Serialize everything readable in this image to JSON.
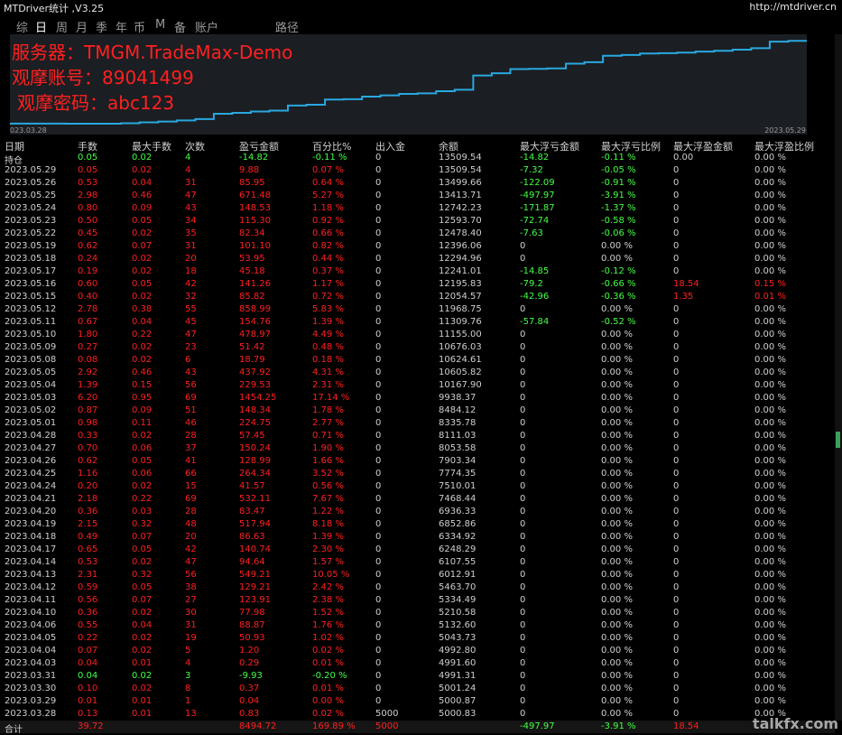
{
  "app_title": "MTDriver统计 ,V3.25",
  "url": "http://mtdriver.cn",
  "tabs": [
    "综",
    "日",
    "周",
    "月",
    "季",
    "年",
    "币",
    "M",
    "备",
    "账户",
    "路径"
  ],
  "active_tab": 1,
  "overlay": {
    "server": "服务器：TMGM.TradeMax-Demo",
    "account": "观摩账号：89041499",
    "password": "观摩密码：abc123"
  },
  "chart_data": {
    "type": "line",
    "x_start_label": "023.03.28",
    "x_end_label": "2023.05.29",
    "line_color": "#29a8e0",
    "series": [
      {
        "x": [
          "2023.03.28",
          "2023.03.29",
          "2023.03.30",
          "2023.03.31",
          "2023.04.03",
          "2023.04.04",
          "2023.04.05",
          "2023.04.06",
          "2023.04.10",
          "2023.04.11",
          "2023.04.12",
          "2023.04.13",
          "2023.04.14",
          "2023.04.17",
          "2023.04.18",
          "2023.04.19",
          "2023.04.20",
          "2023.04.21",
          "2023.04.24",
          "2023.04.25",
          "2023.04.26",
          "2023.04.27",
          "2023.04.28",
          "2023.05.01",
          "2023.05.02",
          "2023.05.03",
          "2023.05.04",
          "2023.05.05",
          "2023.05.08",
          "2023.05.09",
          "2023.05.10",
          "2023.05.11",
          "2023.05.12",
          "2023.05.15",
          "2023.05.16",
          "2023.05.17",
          "2023.05.18",
          "2023.05.19",
          "2023.05.22",
          "2023.05.23",
          "2023.05.24",
          "2023.05.25",
          "2023.05.26",
          "2023.05.29"
        ],
        "values": [
          5000.83,
          5000.87,
          5001.24,
          4991.31,
          4991.6,
          4992.8,
          5043.73,
          5132.6,
          5210.58,
          5334.49,
          5463.7,
          6012.91,
          6107.55,
          6248.29,
          6334.92,
          6852.86,
          6936.33,
          7468.44,
          7510.01,
          7774.35,
          7903.34,
          8053.58,
          8111.03,
          8335.78,
          8484.12,
          9938.37,
          10167.9,
          10605.82,
          10624.61,
          10676.03,
          11155.0,
          11309.76,
          11968.75,
          12054.57,
          12195.83,
          12241.01,
          12294.96,
          12396.06,
          12478.4,
          12593.7,
          12742.23,
          13413.71,
          13499.66,
          13509.54
        ]
      }
    ],
    "ylim": [
      4900,
      13800
    ]
  },
  "table": {
    "headers": [
      "日期",
      "手数",
      "最大手数",
      "次数",
      "盈亏金额",
      "百分比%",
      "出入金",
      "余额",
      "最大浮亏金额",
      "最大浮亏比例",
      "最大浮盈金额",
      "最大浮盈比例"
    ],
    "rows": [
      [
        "持仓",
        "0.05",
        "0.02",
        "4",
        "-14.82",
        "-0.11 %",
        "0",
        "13509.54",
        "-14.82",
        "-0.11 %",
        "0.00",
        "0.00 %"
      ],
      [
        "2023.05.29",
        "0.05",
        "0.02",
        "4",
        "9.88",
        "0.07 %",
        "0",
        "13509.54",
        "-7.32",
        "-0.05 %",
        "0",
        "0.00 %"
      ],
      [
        "2023.05.26",
        "0.53",
        "0.04",
        "31",
        "85.95",
        "0.64 %",
        "0",
        "13499.66",
        "-122.09",
        "-0.91 %",
        "0",
        "0.00 %"
      ],
      [
        "2023.05.25",
        "2.98",
        "0.46",
        "47",
        "671.48",
        "5.27 %",
        "0",
        "13413.71",
        "-497.97",
        "-3.91 %",
        "0",
        "0.00 %"
      ],
      [
        "2023.05.24",
        "0.80",
        "0.09",
        "43",
        "148.53",
        "1.18 %",
        "0",
        "12742.23",
        "-171.87",
        "-1.37 %",
        "0",
        "0.00 %"
      ],
      [
        "2023.05.23",
        "0.50",
        "0.05",
        "34",
        "115.30",
        "0.92 %",
        "0",
        "12593.70",
        "-72.74",
        "-0.58 %",
        "0",
        "0.00 %"
      ],
      [
        "2023.05.22",
        "0.45",
        "0.02",
        "35",
        "82.34",
        "0.66 %",
        "0",
        "12478.40",
        "-7.63",
        "-0.06 %",
        "0",
        "0.00 %"
      ],
      [
        "2023.05.19",
        "0.62",
        "0.07",
        "31",
        "101.10",
        "0.82 %",
        "0",
        "12396.06",
        "0",
        "0.00 %",
        "0",
        "0.00 %"
      ],
      [
        "2023.05.18",
        "0.24",
        "0.02",
        "20",
        "53.95",
        "0.44 %",
        "0",
        "12294.96",
        "0",
        "0.00 %",
        "0",
        "0.00 %"
      ],
      [
        "2023.05.17",
        "0.19",
        "0.02",
        "18",
        "45.18",
        "0.37 %",
        "0",
        "12241.01",
        "-14.85",
        "-0.12 %",
        "0",
        "0.00 %"
      ],
      [
        "2023.05.16",
        "0.60",
        "0.05",
        "42",
        "141.26",
        "1.17 %",
        "0",
        "12195.83",
        "-79.2",
        "-0.66 %",
        "18.54",
        "0.15 %"
      ],
      [
        "2023.05.15",
        "0.40",
        "0.02",
        "32",
        "85.82",
        "0.72 %",
        "0",
        "12054.57",
        "-42.96",
        "-0.36 %",
        "1.35",
        "0.01 %"
      ],
      [
        "2023.05.12",
        "2.78",
        "0.38",
        "55",
        "858.99",
        "5.83 %",
        "0",
        "11968.75",
        "0",
        "0.00 %",
        "0",
        "0.00 %"
      ],
      [
        "2023.05.11",
        "0.67",
        "0.04",
        "45",
        "154.76",
        "1.39 %",
        "0",
        "11309.76",
        "-57.84",
        "-0.52 %",
        "0",
        "0.00 %"
      ],
      [
        "2023.05.10",
        "1.80",
        "0.22",
        "47",
        "478.97",
        "4.49 %",
        "0",
        "11155.00",
        "0",
        "0.00 %",
        "0",
        "0.00 %"
      ],
      [
        "2023.05.09",
        "0.27",
        "0.02",
        "23",
        "51.42",
        "0.48 %",
        "0",
        "10676.03",
        "0",
        "0.00 %",
        "0",
        "0.00 %"
      ],
      [
        "2023.05.08",
        "0.08",
        "0.02",
        "6",
        "18.79",
        "0.18 %",
        "0",
        "10624.61",
        "0",
        "0.00 %",
        "0",
        "0.00 %"
      ],
      [
        "2023.05.05",
        "2.92",
        "0.46",
        "43",
        "437.92",
        "4.31 %",
        "0",
        "10605.82",
        "0",
        "0.00 %",
        "0",
        "0.00 %"
      ],
      [
        "2023.05.04",
        "1.39",
        "0.15",
        "56",
        "229.53",
        "2.31 %",
        "0",
        "10167.90",
        "0",
        "0.00 %",
        "0",
        "0.00 %"
      ],
      [
        "2023.05.03",
        "6.20",
        "0.95",
        "69",
        "1454.25",
        "17.14 %",
        "0",
        "9938.37",
        "0",
        "0.00 %",
        "0",
        "0.00 %"
      ],
      [
        "2023.05.02",
        "0.87",
        "0.09",
        "51",
        "148.34",
        "1.78 %",
        "0",
        "8484.12",
        "0",
        "0.00 %",
        "0",
        "0.00 %"
      ],
      [
        "2023.05.01",
        "0.98",
        "0.11",
        "46",
        "224.75",
        "2.77 %",
        "0",
        "8335.78",
        "0",
        "0.00 %",
        "0",
        "0.00 %"
      ],
      [
        "2023.04.28",
        "0.33",
        "0.02",
        "28",
        "57.45",
        "0.71 %",
        "0",
        "8111.03",
        "0",
        "0.00 %",
        "0",
        "0.00 %"
      ],
      [
        "2023.04.27",
        "0.70",
        "0.06",
        "37",
        "150.24",
        "1.90 %",
        "0",
        "8053.58",
        "0",
        "0.00 %",
        "0",
        "0.00 %"
      ],
      [
        "2023.04.26",
        "0.62",
        "0.05",
        "41",
        "128.99",
        "1.66 %",
        "0",
        "7903.34",
        "0",
        "0.00 %",
        "0",
        "0.00 %"
      ],
      [
        "2023.04.25",
        "1.16",
        "0.06",
        "66",
        "264.34",
        "3.52 %",
        "0",
        "7774.35",
        "0",
        "0.00 %",
        "0",
        "0.00 %"
      ],
      [
        "2023.04.24",
        "0.20",
        "0.02",
        "15",
        "41.57",
        "0.56 %",
        "0",
        "7510.01",
        "0",
        "0.00 %",
        "0",
        "0.00 %"
      ],
      [
        "2023.04.21",
        "2.18",
        "0.22",
        "69",
        "532.11",
        "7.67 %",
        "0",
        "7468.44",
        "0",
        "0.00 %",
        "0",
        "0.00 %"
      ],
      [
        "2023.04.20",
        "0.36",
        "0.03",
        "28",
        "83.47",
        "1.22 %",
        "0",
        "6936.33",
        "0",
        "0.00 %",
        "0",
        "0.00 %"
      ],
      [
        "2023.04.19",
        "2.15",
        "0.32",
        "48",
        "517.94",
        "8.18 %",
        "0",
        "6852.86",
        "0",
        "0.00 %",
        "0",
        "0.00 %"
      ],
      [
        "2023.04.18",
        "0.49",
        "0.07",
        "20",
        "86.63",
        "1.39 %",
        "0",
        "6334.92",
        "0",
        "0.00 %",
        "0",
        "0.00 %"
      ],
      [
        "2023.04.17",
        "0.65",
        "0.05",
        "42",
        "140.74",
        "2.30 %",
        "0",
        "6248.29",
        "0",
        "0.00 %",
        "0",
        "0.00 %"
      ],
      [
        "2023.04.14",
        "0.53",
        "0.02",
        "47",
        "94.64",
        "1.57 %",
        "0",
        "6107.55",
        "0",
        "0.00 %",
        "0",
        "0.00 %"
      ],
      [
        "2023.04.13",
        "2.31",
        "0.32",
        "56",
        "549.21",
        "10.05 %",
        "0",
        "6012.91",
        "0",
        "0.00 %",
        "0",
        "0.00 %"
      ],
      [
        "2023.04.12",
        "0.59",
        "0.05",
        "38",
        "129.21",
        "2.42 %",
        "0",
        "5463.70",
        "0",
        "0.00 %",
        "0",
        "0.00 %"
      ],
      [
        "2023.04.11",
        "0.56",
        "0.07",
        "27",
        "123.91",
        "2.38 %",
        "0",
        "5334.49",
        "0",
        "0.00 %",
        "0",
        "0.00 %"
      ],
      [
        "2023.04.10",
        "0.36",
        "0.02",
        "30",
        "77.98",
        "1.52 %",
        "0",
        "5210.58",
        "0",
        "0.00 %",
        "0",
        "0.00 %"
      ],
      [
        "2023.04.06",
        "0.55",
        "0.04",
        "31",
        "88.87",
        "1.76 %",
        "0",
        "5132.60",
        "0",
        "0.00 %",
        "0",
        "0.00 %"
      ],
      [
        "2023.04.05",
        "0.22",
        "0.02",
        "19",
        "50.93",
        "1.02 %",
        "0",
        "5043.73",
        "0",
        "0.00 %",
        "0",
        "0.00 %"
      ],
      [
        "2023.04.04",
        "0.07",
        "0.02",
        "5",
        "1.20",
        "0.02 %",
        "0",
        "4992.80",
        "0",
        "0.00 %",
        "0",
        "0.00 %"
      ],
      [
        "2023.04.03",
        "0.04",
        "0.01",
        "4",
        "0.29",
        "0.01 %",
        "0",
        "4991.60",
        "0",
        "0.00 %",
        "0",
        "0.00 %"
      ],
      [
        "2023.03.31",
        "0.04",
        "0.02",
        "3",
        "-9.93",
        "-0.20 %",
        "0",
        "4991.31",
        "0",
        "0.00 %",
        "0",
        "0.00 %"
      ],
      [
        "2023.03.30",
        "0.10",
        "0.02",
        "8",
        "0.37",
        "0.01 %",
        "0",
        "5001.24",
        "0",
        "0.00 %",
        "0",
        "0.00 %"
      ],
      [
        "2023.03.29",
        "0.01",
        "0.01",
        "1",
        "0.04",
        "0.00 %",
        "0",
        "5000.87",
        "0",
        "0.00 %",
        "0",
        "0.00 %"
      ],
      [
        "2023.03.28",
        "0.13",
        "0.01",
        "13",
        "0.83",
        "0.02 %",
        "5000",
        "5000.83",
        "0",
        "0.00 %",
        "0",
        "0.00 %"
      ]
    ],
    "total": [
      "合计",
      "39.72",
      "",
      "",
      "8494.72",
      "169.89 %",
      "5000",
      "",
      "-497.97",
      "-3.91 %",
      "18.54",
      ""
    ]
  },
  "colors": {
    "profit": "#ff2020",
    "loss": "#44ff44",
    "neutral": "#cfcfcf",
    "background": "#000000",
    "chart_bg": "#1b1e22"
  },
  "watermark": "talkfx.com"
}
